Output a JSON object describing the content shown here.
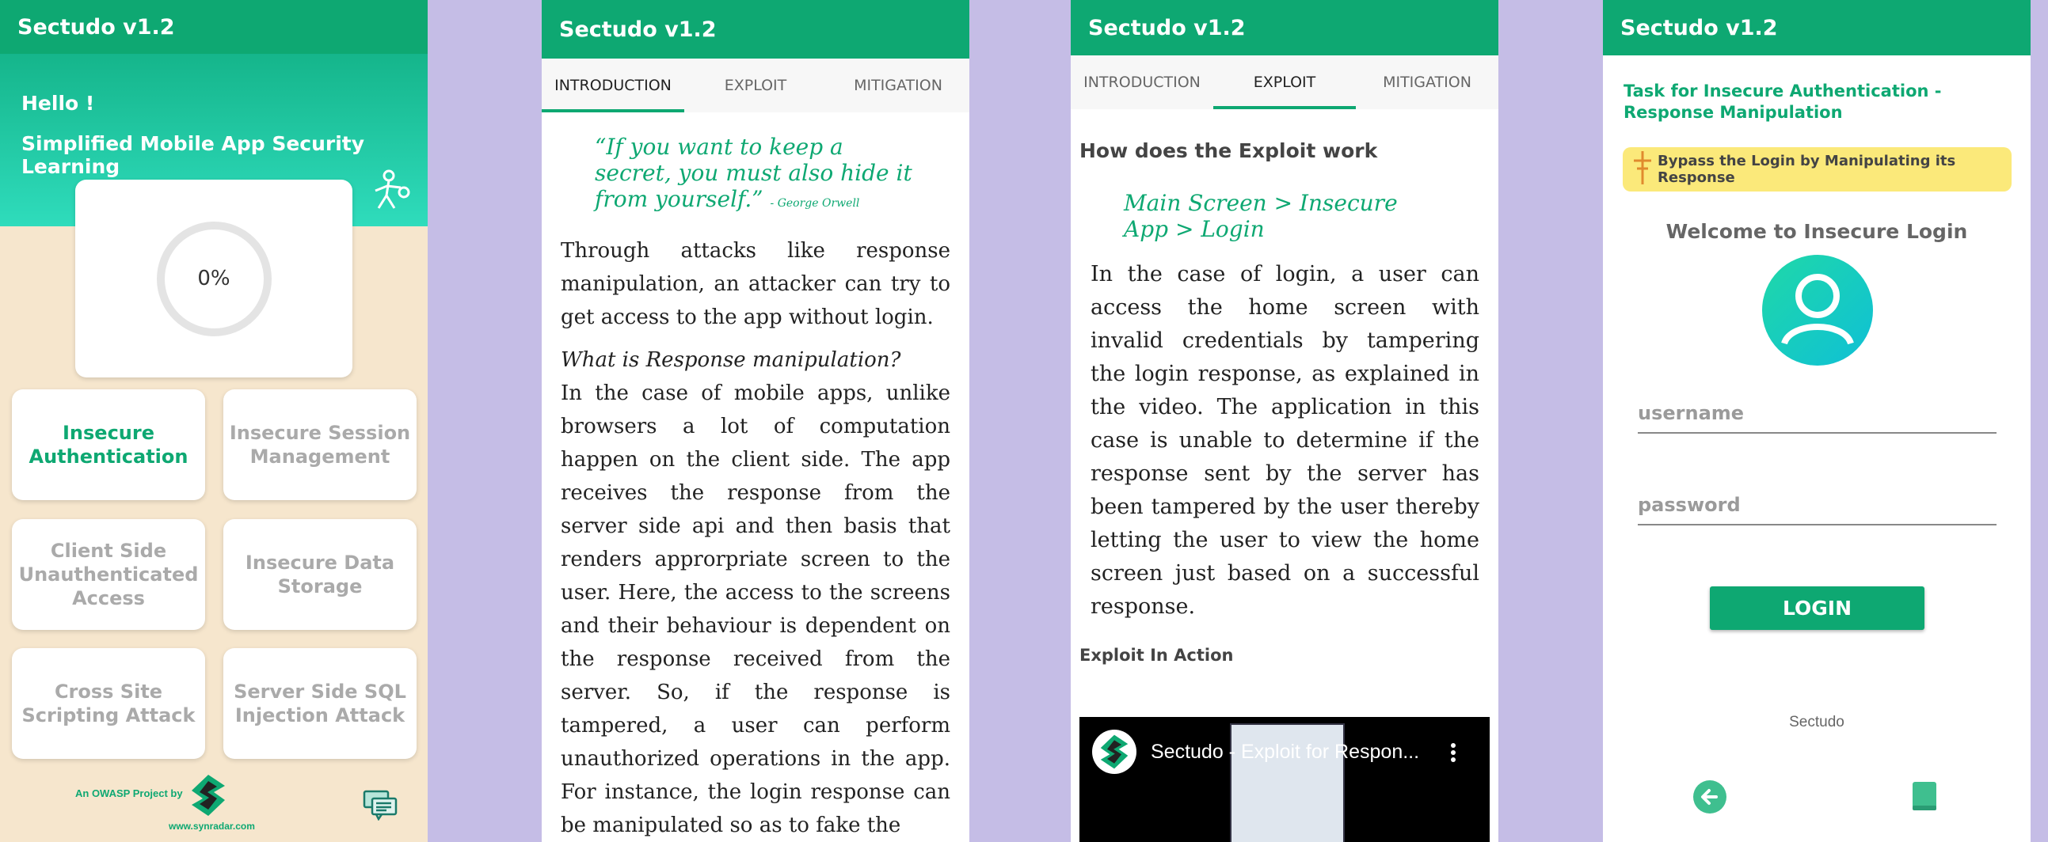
{
  "app_title": "Sectudo v1.2",
  "home": {
    "greeting": "Hello !",
    "tagline": "Simplified Mobile App Security Learning",
    "progress": "0%",
    "modules": [
      {
        "label": "Insecure Authentication"
      },
      {
        "label": "Insecure Session Management"
      },
      {
        "label": "Client Side Unauthenticated Access"
      },
      {
        "label": "Insecure Data Storage"
      },
      {
        "label": "Cross Site Scripting Attack"
      },
      {
        "label": "Server Side SQL Injection Attack"
      }
    ],
    "footer_project": "An OWASP Project by",
    "footer_site": "www.synradar.com"
  },
  "tabs": [
    "INTRODUCTION",
    "EXPLOIT",
    "MITIGATION"
  ],
  "intro": {
    "quote": "“If you want to keep a secret, you must also hide it from yourself.”",
    "quote_author": "- George Orwell",
    "para1": "Through attacks like response manipulation, an attacker can try to get access to the app without login.",
    "question": "What is Response manipulation?",
    "para2": "In the case of mobile apps, unlike browsers a lot of computation happen on the client side. The app receives the response from the server side api and then basis that renders approrpriate screen to the user. Here, the access to the screens and their behaviour is dependent on the response received from the server. So, if the response is tampered, a user can perform unauthorized operations in the app. For instance, the login response can be manipulated so as to fake the"
  },
  "exploit": {
    "heading": "How does the Exploit work",
    "path": "Main Screen > Insecure App > Login",
    "body": "In the case of login, a user can access the home screen with invalid credentials by tampering the login response, as explained in the video. The application in this case is unable to determine if the response sent by the server has been tampered by the user thereby letting the user to view the home screen just based on a successful response.",
    "video_heading": "Exploit In Action",
    "video_title": "Sectudo - Exploit for Respon..."
  },
  "task": {
    "title": "Task for Insecure Authentication - Response Manipulation",
    "banner": "Bypass the Login by Manipulating its Response",
    "welcome": "Welcome to Insecure Login",
    "username_placeholder": "username",
    "password_placeholder": "password",
    "login_label": "LOGIN",
    "brand": "Sectudo"
  },
  "colors": {
    "accent": "#0ea872",
    "background": "#c5bde6",
    "home_bg": "#f6e6cd",
    "banner": "#fbe97a"
  }
}
